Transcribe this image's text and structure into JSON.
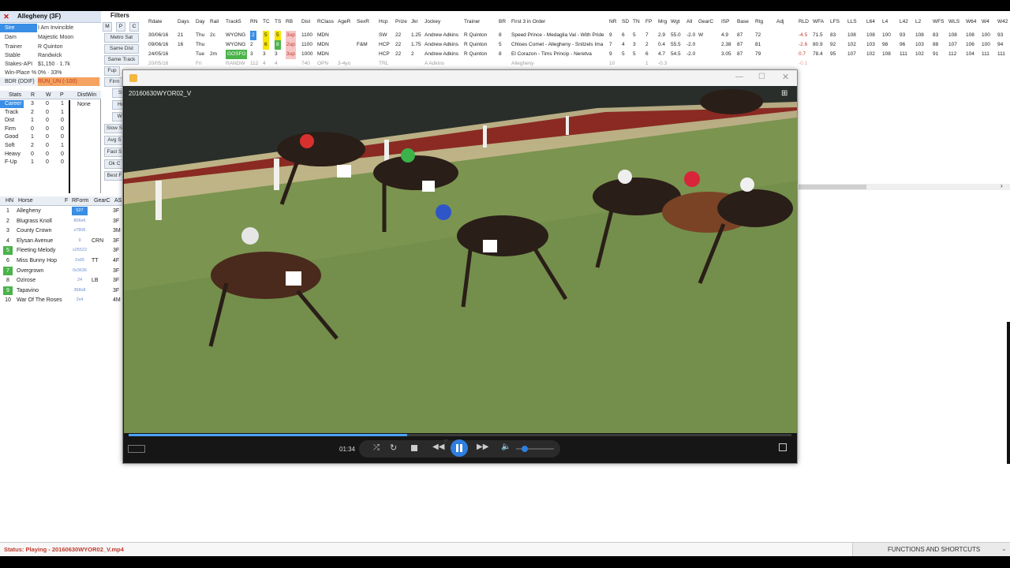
{
  "profile": {
    "horse_title": "Allegheny (3F)",
    "fields": [
      {
        "key": "Sire",
        "value": "I Am Invincible"
      },
      {
        "key": "Dam",
        "value": "Majestic Moon"
      },
      {
        "key": "Trainer",
        "value": "R Quinton"
      },
      {
        "key": "Stable",
        "value": "Randwick"
      },
      {
        "key": "Stakes-API",
        "value": "$1,150 · 1.7k"
      },
      {
        "key": "Win-Place %",
        "value": "0% · 33%"
      },
      {
        "key": "BDR (DDIF)",
        "value": "RUN_UN (-100)"
      }
    ]
  },
  "filters": {
    "title": "Filters",
    "toggles": [
      "M",
      "P",
      "C"
    ],
    "buttons": [
      "Metro Sat",
      "Same Dist",
      "Same Track",
      "Fup",
      "Firm",
      "Hea",
      "WGl",
      "Slow S",
      "Avg S",
      "Fast S",
      "Ok C",
      "Best F",
      "St"
    ]
  },
  "stats": {
    "headers": [
      "Stats",
      "R",
      "W",
      "P",
      "DistWin"
    ],
    "rows": [
      {
        "label": "Career",
        "r": "3",
        "w": "0",
        "p": "1"
      },
      {
        "label": "Track",
        "r": "2",
        "w": "0",
        "p": "1"
      },
      {
        "label": "Dist",
        "r": "1",
        "w": "0",
        "p": "0"
      },
      {
        "label": "Firm",
        "r": "0",
        "w": "0",
        "p": "0"
      },
      {
        "label": "Good",
        "r": "1",
        "w": "0",
        "p": "0"
      },
      {
        "label": "Soft",
        "r": "2",
        "w": "0",
        "p": "1"
      },
      {
        "label": "Heavy",
        "r": "0",
        "w": "0",
        "p": "0"
      },
      {
        "label": "F-Up",
        "r": "1",
        "w": "0",
        "p": "0"
      }
    ],
    "distwin_value": "None"
  },
  "runners": {
    "headers": [
      "HN",
      "Horse",
      "F",
      "RForm",
      "GearC",
      "AS"
    ],
    "rows": [
      {
        "hn": "1",
        "horse": "Allegheny",
        "form": "527",
        "gear": "",
        "as": "3F"
      },
      {
        "hn": "2",
        "horse": "Blugrass Knoll",
        "form": "806x6",
        "gear": "",
        "as": "3F"
      },
      {
        "hn": "3",
        "horse": "County Crown",
        "form": "x7806",
        "gear": "",
        "as": "3M"
      },
      {
        "hn": "4",
        "horse": "Elysan Avenue",
        "form": "9",
        "gear": "CRN",
        "as": "3F"
      },
      {
        "hn": "5",
        "horse": "Fleeting Melody",
        "form": "x25522",
        "gear": "",
        "as": "3F"
      },
      {
        "hn": "6",
        "horse": "Miss Bunny Hop",
        "form": "2x65",
        "gear": "TT",
        "as": "4F"
      },
      {
        "hn": "7",
        "horse": "Overgrown",
        "form": "0x3636",
        "gear": "",
        "as": "3F"
      },
      {
        "hn": "8",
        "horse": "Ozirose",
        "form": "24",
        "gear": "LB",
        "as": "3F"
      },
      {
        "hn": "9",
        "horse": "Tapavino",
        "form": "368x8",
        "gear": "",
        "as": "3F"
      },
      {
        "hn": "10",
        "horse": "War Of The Roses",
        "form": "2x4",
        "gear": "",
        "as": "4M"
      }
    ]
  },
  "grid": {
    "headers": [
      "Rdate",
      "Days",
      "Day",
      "Rail",
      "Track5",
      "RN",
      "TC",
      "TS",
      "RB",
      "Dist",
      "RClass",
      "AgeR",
      "SexR",
      "Hcp",
      "Prize",
      "Jkr",
      "Jockey",
      "Trainer",
      "BR",
      "First 3 in Order",
      "NR",
      "SD",
      "TN",
      "FP",
      "Mrg",
      "Wgt",
      "All",
      "GearC",
      "ISP",
      "Base",
      "Rtg",
      "Adj",
      "RLD",
      "WFA",
      "LFS",
      "LLS",
      "L64",
      "L4",
      "L42",
      "L2",
      "WFS",
      "WLS",
      "W64",
      "W4",
      "W42"
    ],
    "rows": [
      [
        "30/06/16",
        "21",
        "Thu",
        "2c",
        "WYONG",
        "2",
        "5",
        "5",
        "3up",
        "1100",
        "MDN",
        "",
        "",
        "SW",
        "22",
        "1.25",
        "Andrew Adkins",
        "R Quinton",
        "8",
        "Speed Prince - Medaglia Val - With Pride",
        "9",
        "6",
        "5",
        "7",
        "2.9",
        "55.0",
        "-2.0",
        "W",
        "4.9",
        "87",
        "72",
        "",
        "-4.5",
        "71.5",
        "83",
        "108",
        "108",
        "100",
        "93",
        "108",
        "83",
        "108",
        "108",
        "100",
        "93"
      ],
      [
        "09/06/16",
        "16",
        "Thu",
        "",
        "WYONG",
        "2",
        "6",
        "8",
        "2up",
        "1100",
        "MDN",
        "",
        "F&M",
        "HCP",
        "22",
        "1.75",
        "Andrew Adkins",
        "R Quinton",
        "5",
        "Chloes Comet - Allegheny - Snitzels Ima",
        "7",
        "4",
        "3",
        "2",
        "0.4",
        "55.5",
        "-2.0",
        "",
        "2.38",
        "87",
        "81",
        "",
        "-2.6",
        "80.9",
        "92",
        "102",
        "103",
        "98",
        "96",
        "103",
        "88",
        "107",
        "106",
        "100",
        "94"
      ],
      [
        "24/05/16",
        "",
        "Tue",
        "2m",
        "GOSFO",
        "3",
        "3",
        "3",
        "3up",
        "1000",
        "MDN",
        "",
        "",
        "HCP",
        "22",
        "2",
        "Andrew Adkins",
        "R Quinton",
        "8",
        "El Corazon - Tims Princip - Neretva",
        "9",
        "5",
        "5",
        "6",
        "4.7",
        "54.5",
        "-2.0",
        "",
        "3.05",
        "87",
        "79",
        "",
        "0.7",
        "78.4",
        "95",
        "107",
        "102",
        "108",
        "111",
        "102",
        "91",
        "112",
        "104",
        "111",
        "111"
      ],
      [
        "20/05/16",
        "",
        "Fri",
        "",
        "RANDW",
        "112",
        "4",
        "4",
        "",
        "740",
        "OPN",
        "3-4yo",
        "",
        "TRL",
        "",
        "",
        "A Adkins",
        "",
        "",
        "Allegheny",
        "10",
        "",
        "",
        "1",
        "-0.3",
        "",
        "",
        "",
        "",
        "",
        "",
        "",
        "-0.1",
        "",
        "",
        "",
        "",
        "",
        "",
        "",
        "",
        "",
        "",
        "",
        ""
      ]
    ]
  },
  "player": {
    "window_title": "",
    "video_label": "20160630WYOR02_V",
    "time": "01:34",
    "progress": 0.42,
    "volume": 0.15
  },
  "status": {
    "text": "Status: Playing - 20160630WYOR02_V.mp4",
    "functions": "FUNCTIONS AND SHORTCUTS"
  },
  "colors": {
    "status_red": "#c0392b",
    "highlight_green": "#4bb34b",
    "highlight_yellow": "#f5e400",
    "highlight_blue": "#3a8ee6",
    "bdr_orange": "#f4a460"
  }
}
